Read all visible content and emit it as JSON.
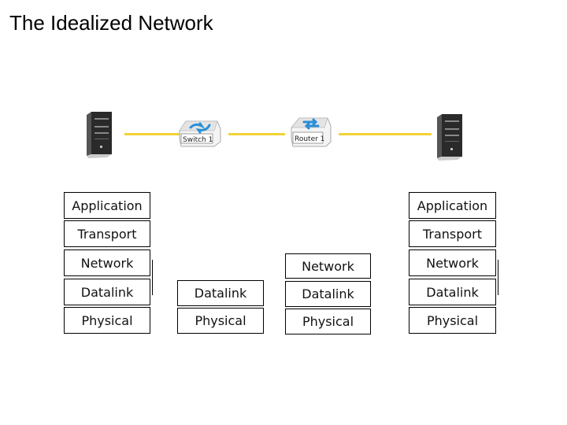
{
  "title": "The Idealized Network",
  "devices": {
    "host_left": {
      "type": "server-icon"
    },
    "switch": {
      "type": "switch-icon",
      "label": "Switch 1"
    },
    "router": {
      "type": "router-icon",
      "label": "Router 1"
    },
    "host_right": {
      "type": "server-icon"
    }
  },
  "colors": {
    "link": "#f2d236",
    "device_arrow": "#2a8fd8"
  },
  "stacks": {
    "host_left": [
      "Application",
      "Transport",
      "Network",
      "Datalink",
      "Physical"
    ],
    "switch": [
      "Datalink",
      "Physical"
    ],
    "router": [
      "Network",
      "Datalink",
      "Physical"
    ],
    "host_right": [
      "Application",
      "Transport",
      "Network",
      "Datalink",
      "Physical"
    ]
  }
}
